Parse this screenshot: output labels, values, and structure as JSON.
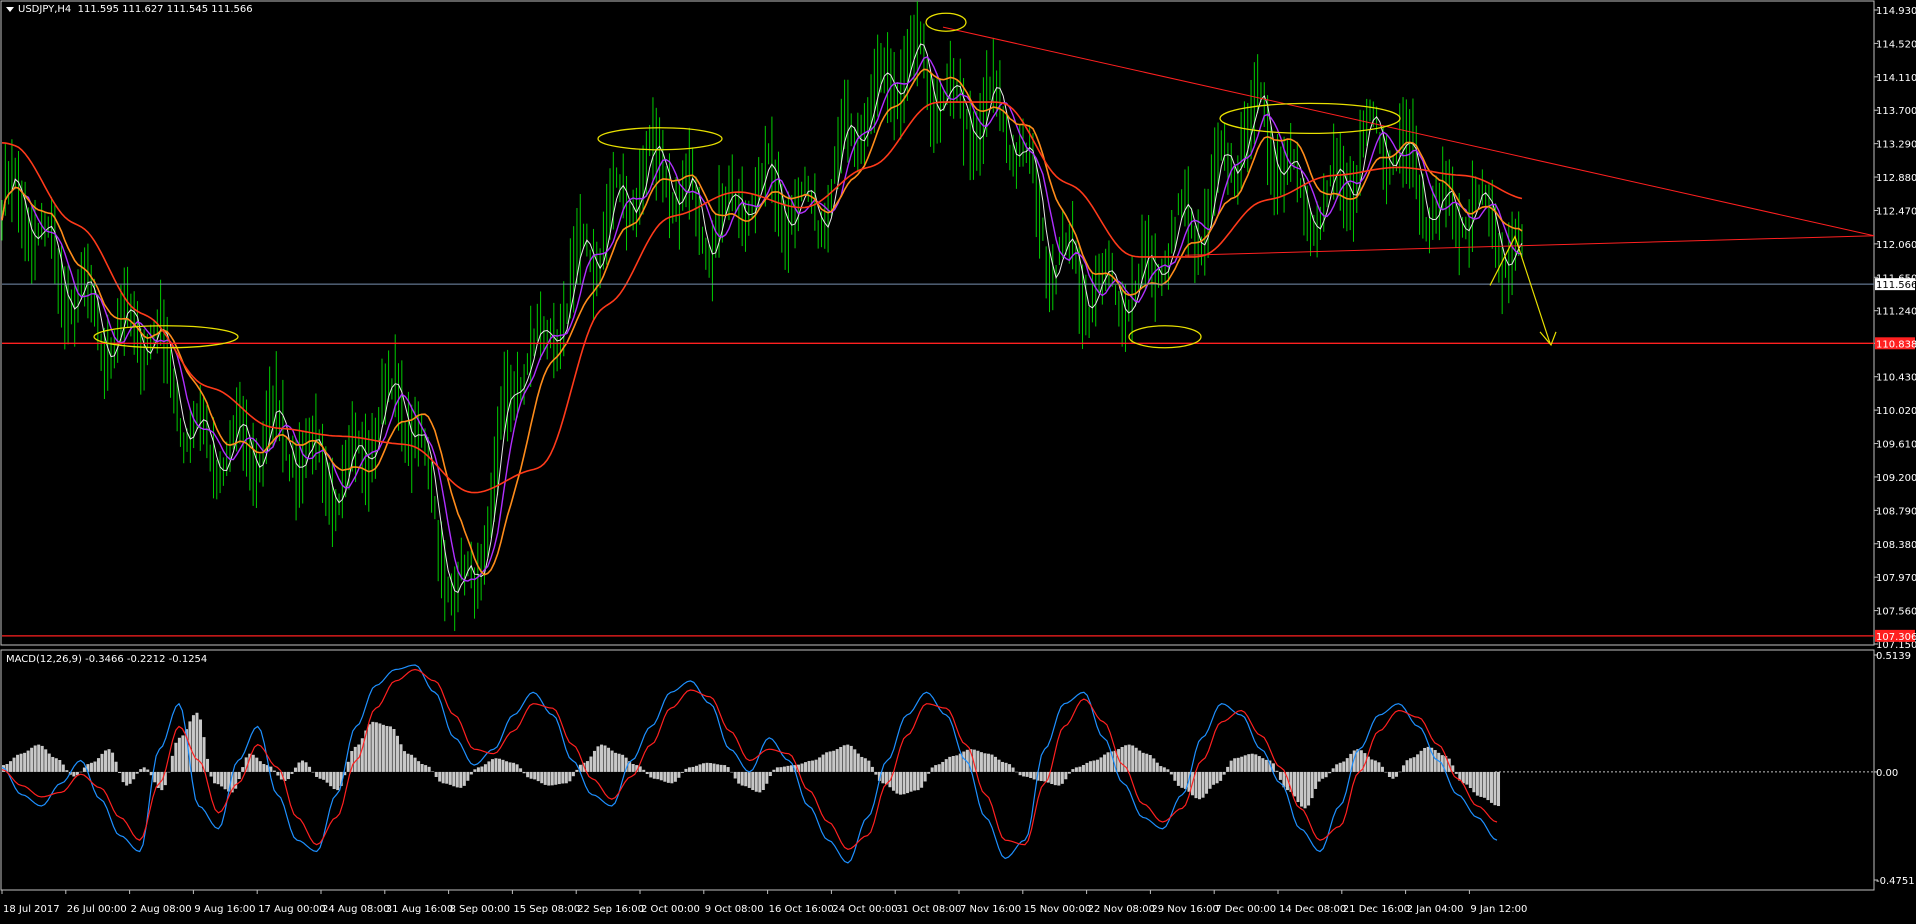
{
  "header": {
    "symbol": "USDJPY,H4",
    "ohlc": "111.595 111.627 111.545 111.566"
  },
  "macd_header": {
    "label": "MACD(12,26,9) -0.3466 -0.2212 -0.1254"
  },
  "colors": {
    "background": "#000000",
    "candles": "#00cc00",
    "ma_white": "#e8e8e8",
    "ma_purple": "#b030ff",
    "ma_orange": "#ff8c1a",
    "ma_red": "#ff3a1a",
    "trendline": "#ff2020",
    "annotation": "#e8e000",
    "macd_blue": "#1e90ff",
    "macd_red": "#ff2020",
    "histogram": "#c8c8c8",
    "current_price_line": "#7890b0"
  },
  "chart_data": [
    {
      "type": "line",
      "title": "USDJPY,H4",
      "x_ticks": [
        "18 Jul 2017",
        "26 Jul 00:00",
        "2 Aug 08:00",
        "9 Aug 16:00",
        "17 Aug 00:00",
        "24 Aug 08:00",
        "31 Aug 16:00",
        "8 Sep 00:00",
        "15 Sep 08:00",
        "22 Sep 16:00",
        "2 Oct 00:00",
        "9 Oct 08:00",
        "16 Oct 16:00",
        "24 Oct 00:00",
        "31 Oct 08:00",
        "7 Nov 16:00",
        "15 Nov 00:00",
        "22 Nov 08:00",
        "29 Nov 16:00",
        "7 Dec 00:00",
        "14 Dec 08:00",
        "21 Dec 16:00",
        "2 Jan 04:00",
        "9 Jan 12:00"
      ],
      "y_ticks": [
        "114.930",
        "114.520",
        "114.110",
        "113.700",
        "113.290",
        "112.880",
        "112.470",
        "112.060",
        "111.650",
        "111.240",
        "110.840",
        "110.430",
        "110.020",
        "109.610",
        "109.200",
        "108.790",
        "108.380",
        "107.970",
        "107.560",
        "107.150"
      ],
      "ylim": [
        107.15,
        114.93
      ],
      "current_price": 111.566,
      "current_price_label": "111.566",
      "support_levels": [
        {
          "value": 110.84,
          "label": "110.838"
        },
        {
          "value": 107.25,
          "label": "107.306"
        }
      ],
      "series": [
        {
          "name": "",
          "color": "#00cc00",
          "x": [
            "18 Jul 2017",
            "26 Jul 00:00",
            "2 Aug 08:00",
            "9 Aug 16:00",
            "17 Aug 00:00",
            "24 Aug 08:00",
            "31 Aug 16:00",
            "8 Sep 00:00",
            "15 Sep 08:00",
            "22 Sep 16:00",
            "2 Oct 00:00",
            "9 Oct 08:00",
            "16 Oct 16:00",
            "24 Oct 00:00",
            "31 Oct 08:00",
            "7 Nov 16:00",
            "15 Nov 00:00",
            "22 Nov 08:00",
            "29 Nov 16:00",
            "7 Dec 00:00",
            "14 Dec 08:00",
            "21 Dec 16:00",
            "2 Jan 04:00",
            "9 Jan 12:00"
          ],
          "values": [
            112.5,
            111.6,
            110.9,
            109.8,
            109.5,
            109.4,
            109.9,
            108.0,
            110.5,
            112.3,
            112.8,
            112.5,
            112.5,
            113.5,
            114.2,
            113.5,
            112.1,
            111.2,
            112.5,
            113.3,
            112.7,
            113.2,
            112.6,
            111.6
          ]
        },
        {
          "name": "",
          "color": "#ff8c1a",
          "x": [
            "18 Jul 2017",
            "26 Jul 00:00",
            "2 Aug 08:00",
            "9 Aug 16:00",
            "17 Aug 00:00",
            "24 Aug 08:00",
            "31 Aug 16:00",
            "8 Sep 00:00",
            "15 Sep 08:00",
            "22 Sep 16:00",
            "2 Oct 00:00",
            "9 Oct 08:00",
            "16 Oct 16:00",
            "24 Oct 00:00",
            "31 Oct 08:00",
            "7 Nov 16:00",
            "15 Nov 00:00",
            "22 Nov 08:00",
            "29 Nov 16:00",
            "7 Dec 00:00",
            "14 Dec 08:00",
            "21 Dec 16:00",
            "2 Jan 04:00",
            "9 Jan 12:00"
          ],
          "values": [
            113.3,
            112.3,
            111.2,
            110.3,
            109.8,
            109.7,
            109.6,
            109.0,
            109.3,
            111.3,
            112.4,
            112.7,
            112.5,
            113.0,
            113.8,
            113.8,
            112.8,
            111.9,
            111.9,
            112.6,
            112.9,
            113.0,
            112.9,
            112.6
          ]
        }
      ],
      "annotations": [
        "resistance ellipses",
        "support ellipses",
        "descending trendline",
        "projection arrow"
      ]
    },
    {
      "type": "bar",
      "title": "MACD(12,26,9) -0.3466 -0.2212 -0.1254",
      "y_ticks": [
        "0.5139",
        "0.00",
        "-0.4751"
      ],
      "ylim": [
        -0.4751,
        0.5139
      ],
      "histogram_values": [
        0.03,
        0.08,
        0.12,
        0.06,
        -0.02,
        0.04,
        0.1,
        -0.06,
        0.02,
        -0.08,
        0.15,
        0.26,
        -0.05,
        -0.09,
        0.08,
        0.03,
        -0.04,
        0.05,
        -0.03,
        -0.08,
        0.11,
        0.22,
        0.2,
        0.08,
        0.03,
        -0.05,
        -0.07,
        0.02,
        0.06,
        0.04,
        -0.03,
        -0.06,
        -0.05,
        0.04,
        0.12,
        0.08,
        0.03,
        -0.03,
        -0.05,
        0.02,
        0.04,
        0.03,
        -0.06,
        -0.09,
        0.02,
        0.03,
        0.05,
        0.09,
        0.12,
        0.06,
        -0.05,
        -0.1,
        -0.08,
        0.03,
        0.07,
        0.1,
        0.08,
        0.04,
        -0.02,
        -0.04,
        -0.06,
        0.02,
        0.05,
        0.09,
        0.12,
        0.08,
        0.02,
        -0.07,
        -0.12,
        -0.05,
        0.06,
        0.08,
        0.05,
        -0.08,
        -0.16,
        -0.03,
        0.04,
        0.1,
        0.05,
        -0.03,
        0.06,
        0.11,
        0.07,
        -0.05,
        -0.11,
        -0.15
      ],
      "macd_values": [
        0.02,
        -0.1,
        -0.15,
        -0.05,
        0.05,
        -0.12,
        -0.28,
        -0.35,
        0.1,
        0.3,
        -0.15,
        -0.25,
        0.05,
        0.2,
        -0.1,
        -0.3,
        -0.35,
        -0.1,
        0.2,
        0.38,
        0.45,
        0.47,
        0.35,
        0.15,
        0.03,
        0.1,
        0.25,
        0.35,
        0.25,
        0.05,
        -0.1,
        -0.15,
        0.05,
        0.2,
        0.35,
        0.4,
        0.3,
        0.1,
        0.0,
        0.15,
        0.05,
        -0.15,
        -0.3,
        -0.4,
        -0.2,
        0.05,
        0.25,
        0.35,
        0.25,
        0.05,
        -0.2,
        -0.38,
        -0.3,
        0.1,
        0.3,
        0.35,
        0.15,
        -0.05,
        -0.2,
        -0.25,
        -0.1,
        0.15,
        0.3,
        0.25,
        0.1,
        -0.05,
        -0.25,
        -0.35,
        -0.15,
        0.1,
        0.25,
        0.3,
        0.2,
        0.05,
        -0.1,
        -0.2,
        -0.3
      ],
      "signal_values": [
        0.01,
        -0.06,
        -0.11,
        -0.09,
        -0.01,
        -0.07,
        -0.2,
        -0.3,
        -0.05,
        0.2,
        0.05,
        -0.18,
        -0.05,
        0.12,
        0.02,
        -0.2,
        -0.32,
        -0.2,
        0.05,
        0.28,
        0.4,
        0.45,
        0.4,
        0.25,
        0.1,
        0.08,
        0.18,
        0.3,
        0.28,
        0.12,
        -0.03,
        -0.12,
        -0.02,
        0.12,
        0.28,
        0.36,
        0.33,
        0.18,
        0.05,
        0.1,
        0.08,
        -0.08,
        -0.22,
        -0.34,
        -0.28,
        -0.05,
        0.16,
        0.3,
        0.28,
        0.12,
        -0.1,
        -0.3,
        -0.32,
        -0.05,
        0.2,
        0.32,
        0.22,
        0.03,
        -0.14,
        -0.22,
        -0.16,
        0.05,
        0.22,
        0.27,
        0.16,
        0.02,
        -0.16,
        -0.3,
        -0.24,
        0.0,
        0.18,
        0.27,
        0.24,
        0.12,
        -0.03,
        -0.15,
        -0.22
      ]
    }
  ]
}
